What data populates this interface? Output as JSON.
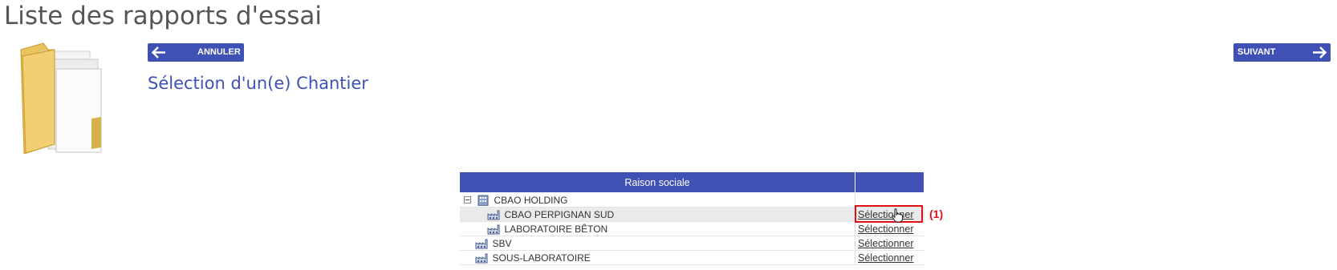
{
  "page": {
    "title": "Liste des rapports d'essai"
  },
  "toolbar": {
    "cancel_label": "ANNULER",
    "next_label": "SUIVANT"
  },
  "section": {
    "title": "Sélection d'un(e) Chantier"
  },
  "table": {
    "columns": [
      "Raison sociale",
      ""
    ],
    "rows": [
      {
        "name": "CBAO HOLDING",
        "action": ""
      },
      {
        "name": "CBAO PERPIGNAN SUD",
        "action": "Sélectionner"
      },
      {
        "name": "LABORATOIRE BÊTON",
        "action": "Sélectionner"
      },
      {
        "name": "SBV",
        "action": "Sélectionner"
      },
      {
        "name": "SOUS-LABORATOIRE",
        "action": "Sélectionner"
      }
    ]
  },
  "annotation": {
    "label": "(1)"
  },
  "colors": {
    "accent": "#3f51b5",
    "marker": "#e0101a",
    "title_text": "#555555"
  },
  "icons": {
    "page": "folder-documents-icon",
    "back": "arrow-left-icon",
    "next": "arrow-right-icon",
    "company": "building-icon",
    "site": "factory-icon"
  }
}
